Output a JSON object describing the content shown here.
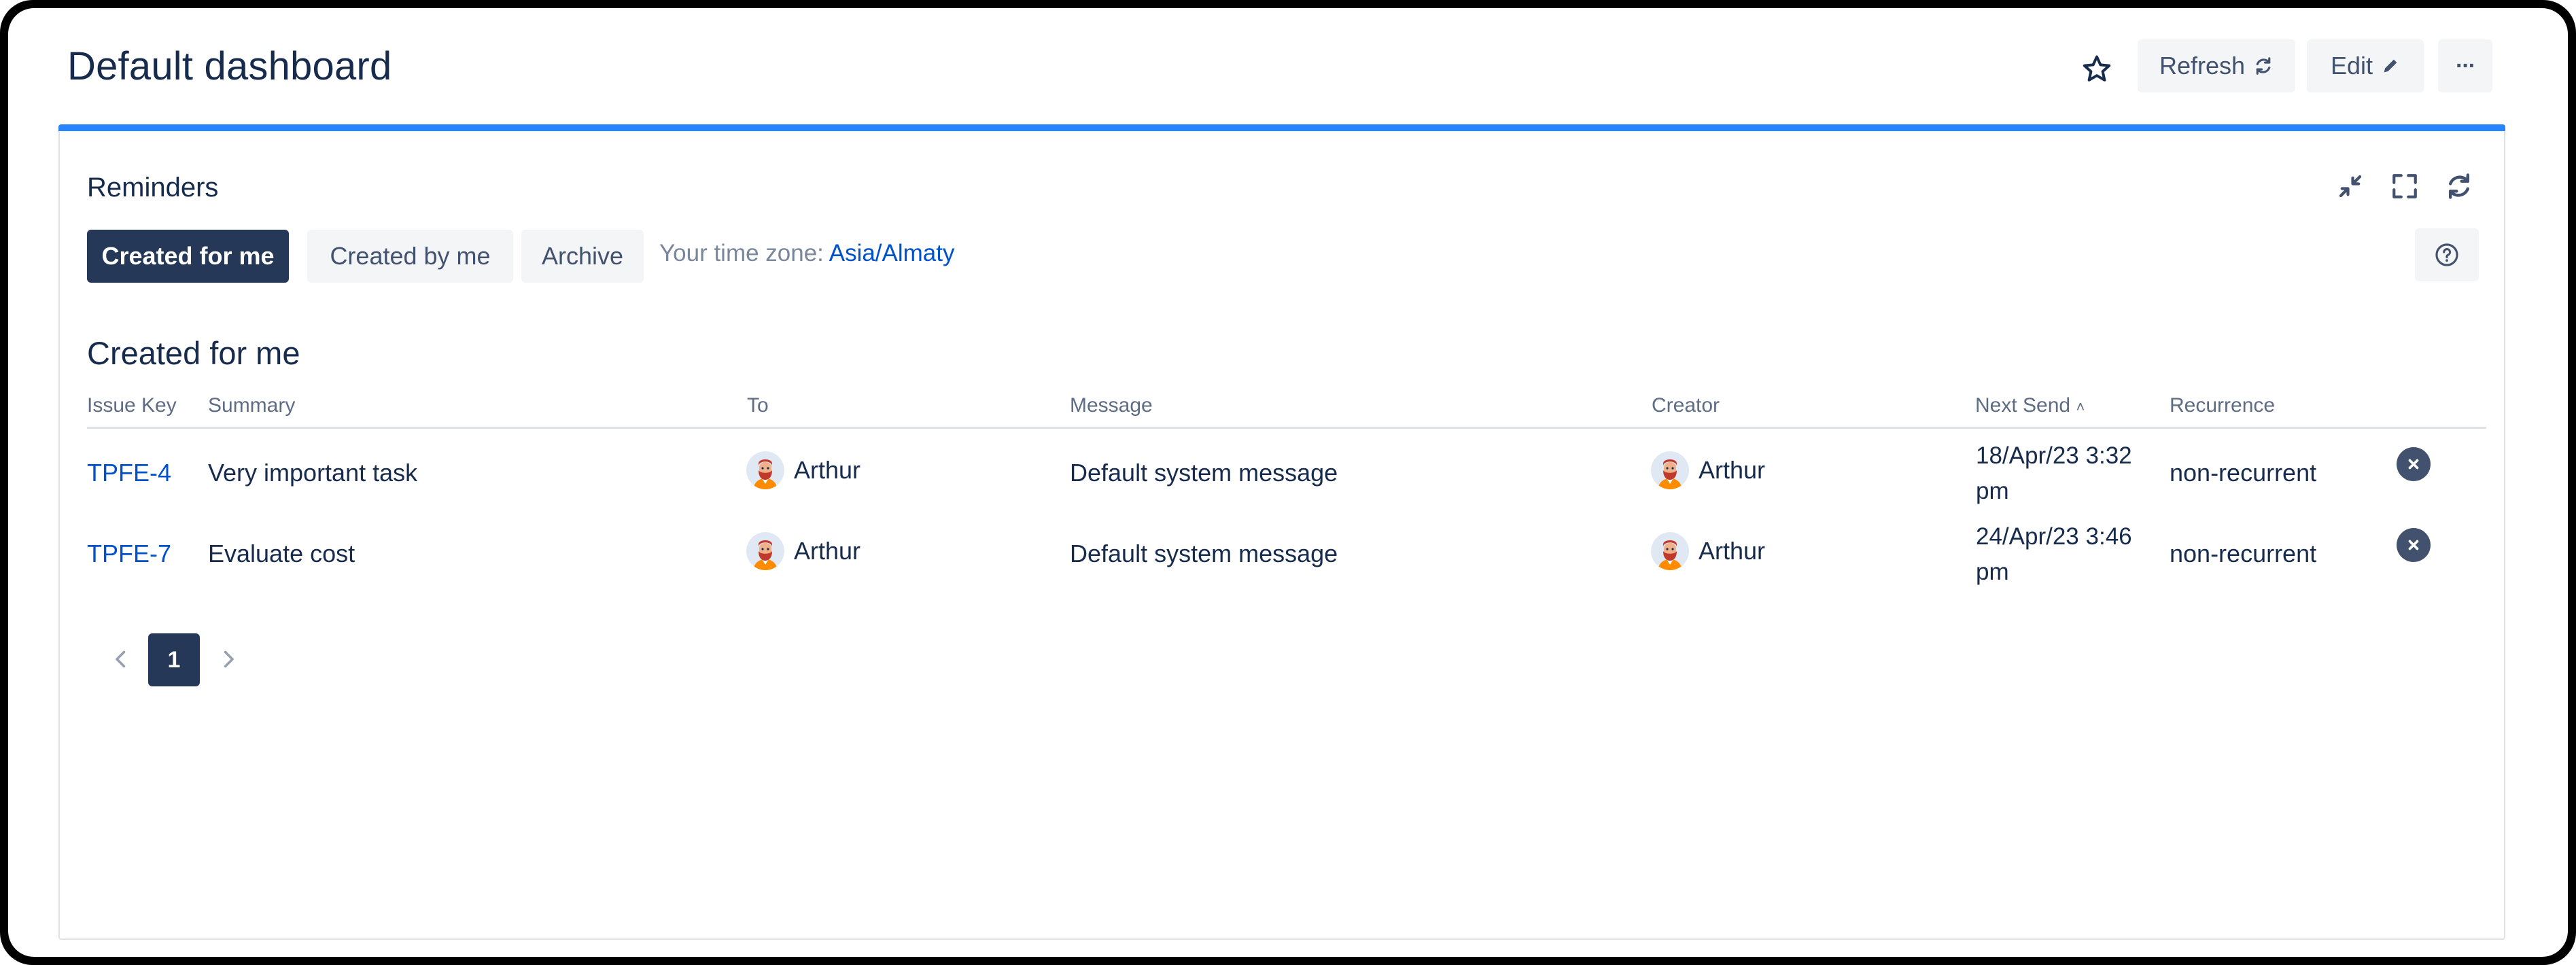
{
  "page": {
    "title": "Default dashboard"
  },
  "header": {
    "refresh_label": "Refresh",
    "edit_label": "Edit",
    "more_label": "···"
  },
  "gadget": {
    "title": "Reminders",
    "tabs": [
      {
        "label": "Created for me",
        "active": true
      },
      {
        "label": "Created by me",
        "active": false
      },
      {
        "label": "Archive",
        "active": false
      }
    ],
    "timezone_prefix": "Your time zone:",
    "timezone_value": "Asia/Almaty",
    "section_title": "Created for me",
    "columns": [
      "Issue Key",
      "Summary",
      "To",
      "Message",
      "Creator",
      "Next Send",
      "Recurrence"
    ],
    "next_send_sort_indicator": "˄",
    "rows": [
      {
        "issue_key": "TPFE-4",
        "summary": "Very important task",
        "to": "Arthur",
        "message": "Default system message",
        "creator": "Arthur",
        "next_send": "18/Apr/23 3:32 pm",
        "recurrence": "non-recurrent"
      },
      {
        "issue_key": "TPFE-7",
        "summary": "Evaluate cost",
        "to": "Arthur",
        "message": "Default system message",
        "creator": "Arthur",
        "next_send": "24/Apr/23 3:46 pm",
        "recurrence": "non-recurrent"
      }
    ],
    "pagination": {
      "current": "1"
    }
  },
  "colors": {
    "accent_blue": "#2684ff",
    "link": "#0052cc",
    "dark_button": "#253858",
    "light_button": "#f4f5f7"
  },
  "icons": {
    "star": "star-icon",
    "refresh": "refresh-icon",
    "edit": "pencil-icon",
    "minimize": "minimize-icon",
    "maximize": "maximize-icon",
    "reload": "reload-icon",
    "help": "help-icon",
    "delete": "delete-icon",
    "prev": "chevron-left-icon",
    "next": "chevron-right-icon"
  }
}
